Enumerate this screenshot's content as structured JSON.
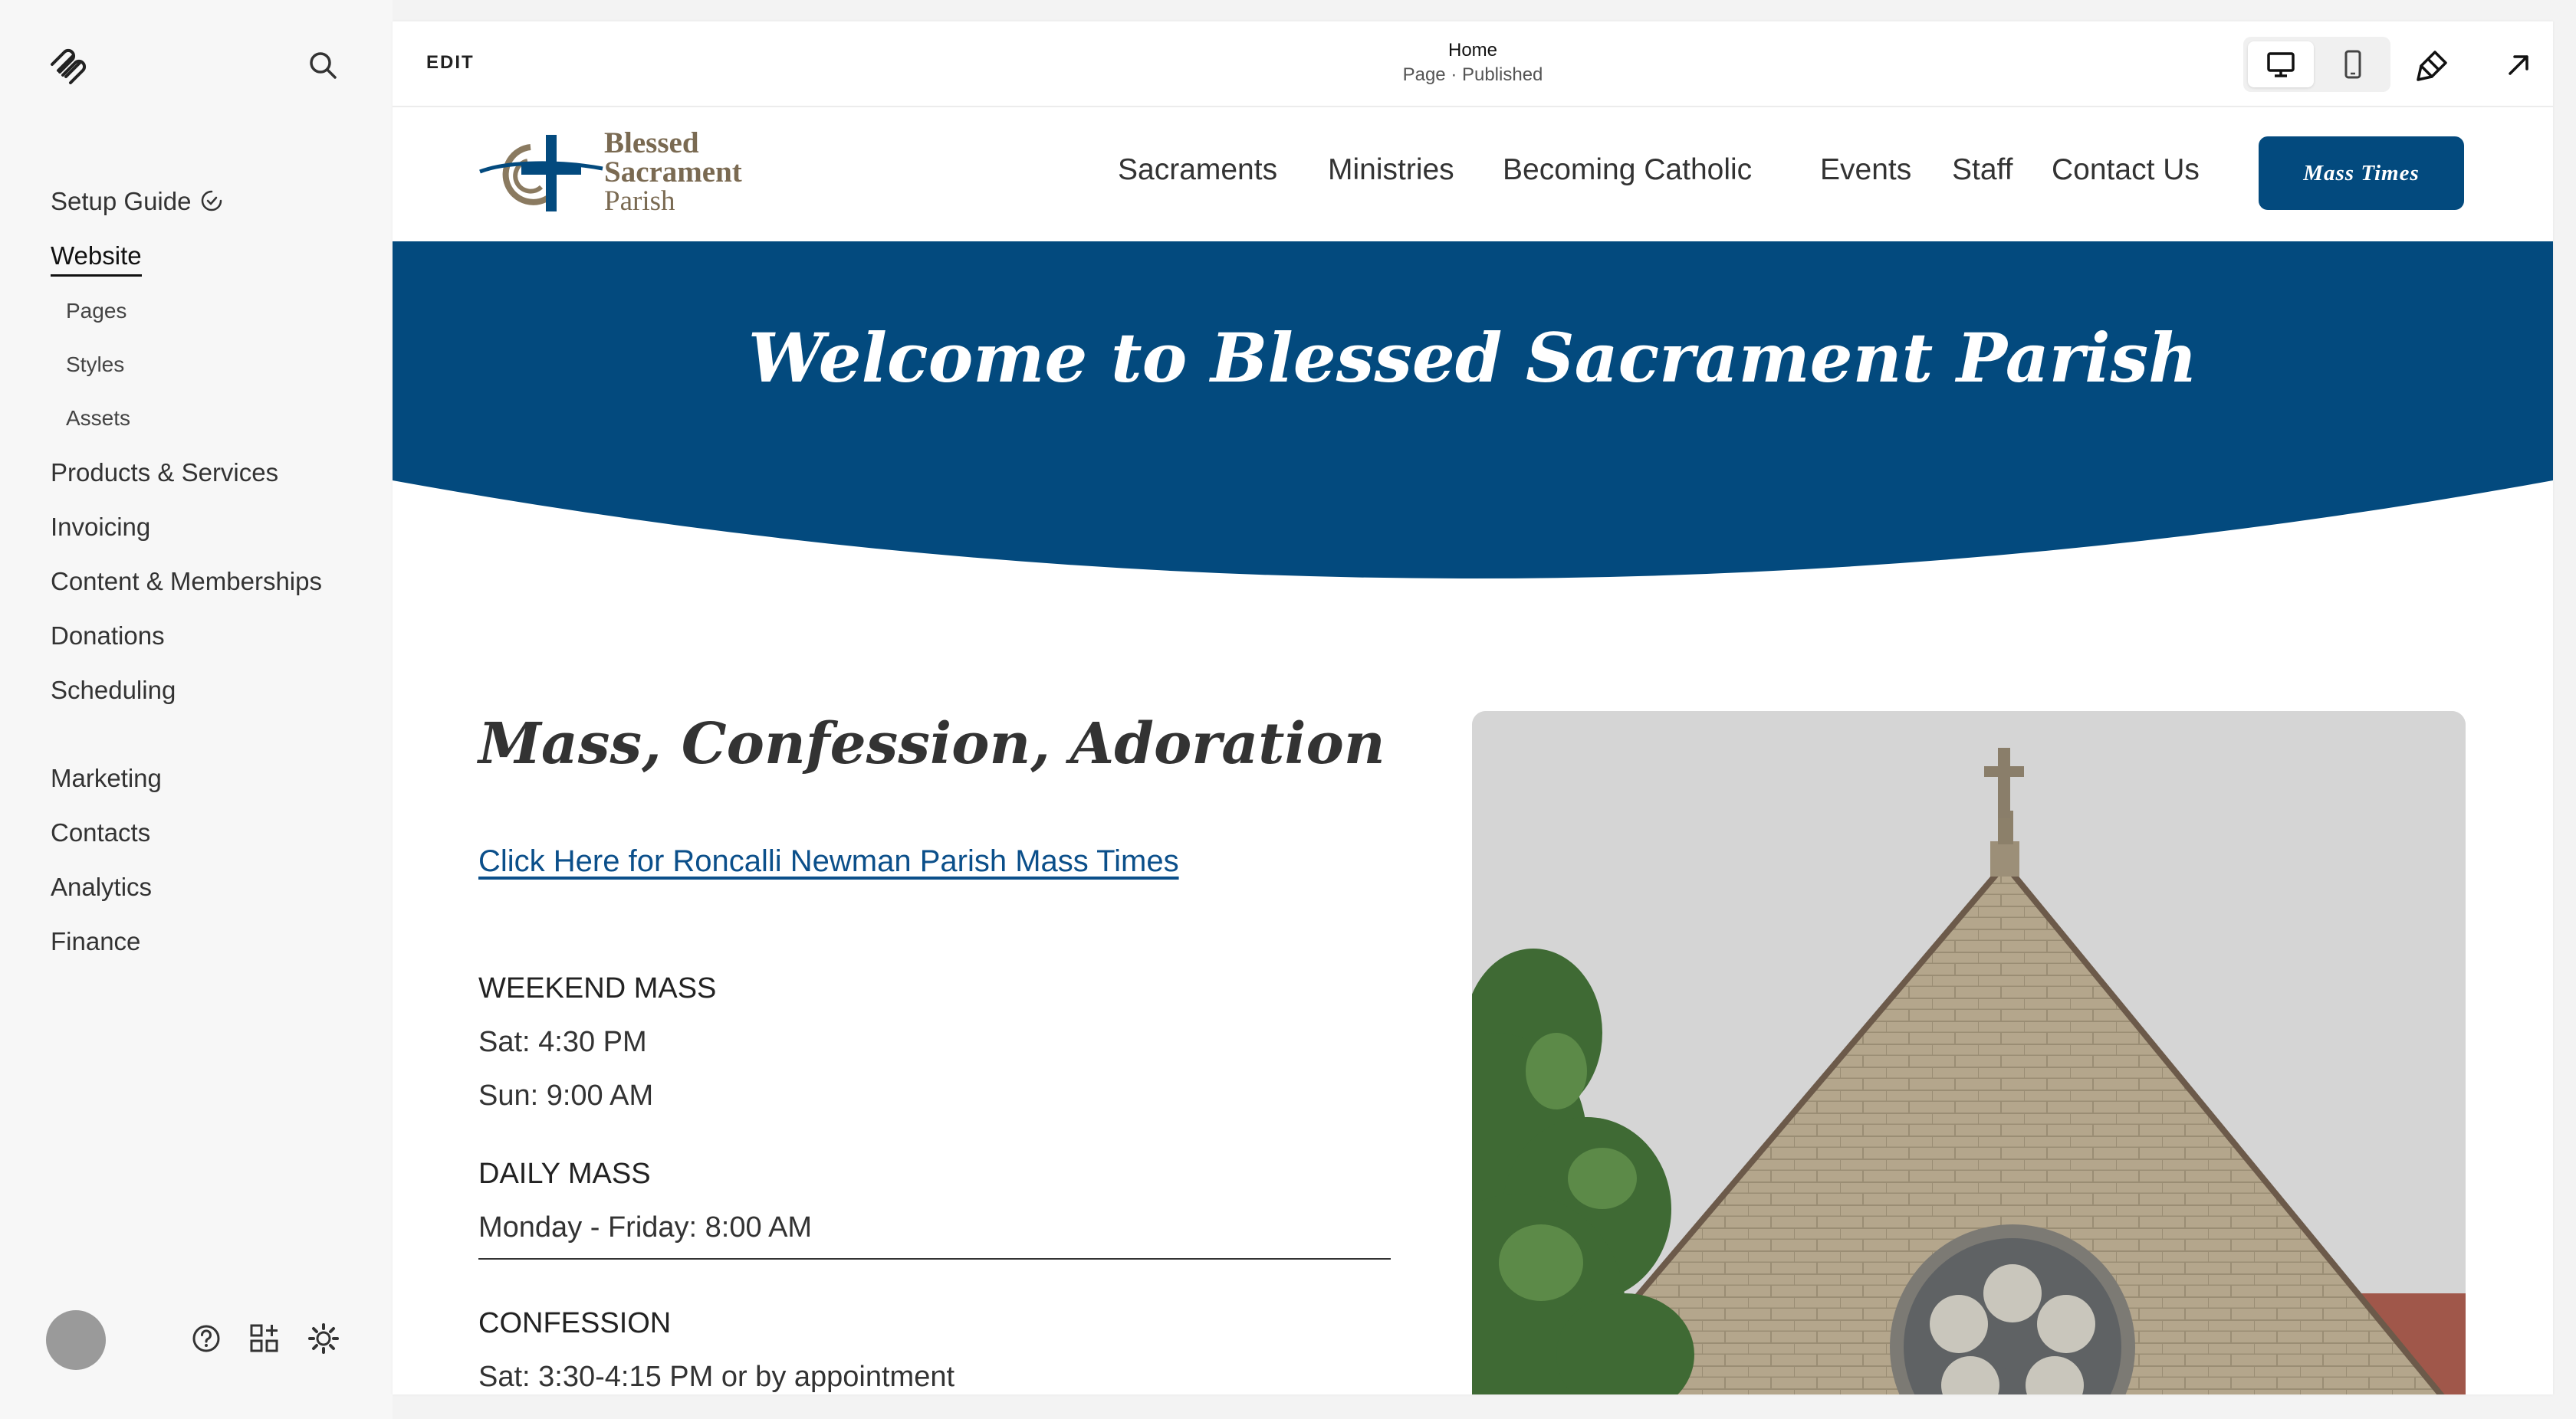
{
  "sidebar": {
    "setup_guide": "Setup Guide",
    "website": "Website",
    "sub_items": [
      "Pages",
      "Styles",
      "Assets"
    ],
    "items": [
      "Products & Services",
      "Invoicing",
      "Content & Memberships",
      "Donations",
      "Scheduling"
    ],
    "items2": [
      "Marketing",
      "Contacts",
      "Analytics",
      "Finance"
    ]
  },
  "topbar": {
    "edit": "EDIT",
    "page_title": "Home",
    "page_status": "Page · Published"
  },
  "site": {
    "logo": [
      "Blessed",
      "Sacrament",
      "Parish"
    ],
    "nav": [
      "Sacraments",
      "Ministries",
      "Becoming Catholic",
      "Events",
      "Staff",
      "Contact Us"
    ],
    "cta": "Mass Times",
    "hero_title": "Welcome to Blessed Sacrament Parish",
    "section_title": "Mass, Confession, Adoration",
    "link": "Click Here for Roncalli Newman Parish Mass Times",
    "weekend_head": "WEEKEND MASS",
    "weekend_sat": "Sat:  4:30 PM",
    "weekend_sun": "Sun:  9:00 AM",
    "daily_head": "DAILY MASS",
    "daily_line": "Monday - Friday: 8:00 AM",
    "confession_head": "CONFESSION",
    "confession_line": "Sat: 3:30-4:15 PM or by appointment"
  },
  "colors": {
    "brand_blue": "#034a7e",
    "link_blue": "#0b4f8a",
    "logo_gold": "#7a6a52"
  },
  "icons": [
    "squarespace-logo-icon",
    "search-icon",
    "setup-progress-icon",
    "help-icon",
    "apps-icon",
    "settings-icon",
    "desktop-icon",
    "mobile-icon",
    "style-brush-icon",
    "open-external-icon"
  ]
}
